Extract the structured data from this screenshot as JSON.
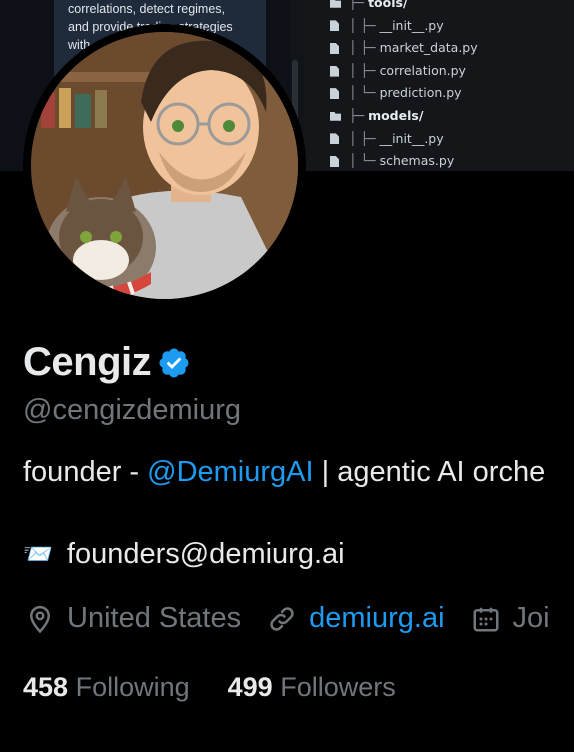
{
  "banner": {
    "text_lines": [
      "correlations, detect regimes,",
      "and provide trading strategies",
      "with"
    ],
    "file_tree": [
      {
        "type": "dir",
        "prefix": "├─",
        "name": "tools/"
      },
      {
        "type": "file",
        "prefix": "│ ├─",
        "name": "__init__.py"
      },
      {
        "type": "file",
        "prefix": "│ ├─",
        "name": "market_data.py"
      },
      {
        "type": "file",
        "prefix": "│ ├─",
        "name": "correlation.py"
      },
      {
        "type": "file",
        "prefix": "│ └─",
        "name": "prediction.py"
      },
      {
        "type": "dir",
        "prefix": "├─",
        "name": "models/"
      },
      {
        "type": "file",
        "prefix": "│ ├─",
        "name": "__init__.py"
      },
      {
        "type": "file",
        "prefix": "│ └─",
        "name": "schemas.py"
      }
    ]
  },
  "profile": {
    "name": "Cengiz",
    "handle": "@cengizdemiurg",
    "bio_prefix": "founder - ",
    "bio_mention": "@DemiurgAI",
    "bio_suffix": " | agentic AI orche",
    "email_icon": "📨",
    "email": "founders@demiurg.ai",
    "location": "United States",
    "website": "demiurg.ai",
    "joined": "Joi",
    "following_count": "458",
    "following_label": "Following",
    "followers_count": "499",
    "followers_label": "Followers"
  },
  "colors": {
    "background": "#000000",
    "primary_text": "#e7e9ea",
    "secondary_text": "#71767b",
    "accent": "#1d9bf0"
  }
}
